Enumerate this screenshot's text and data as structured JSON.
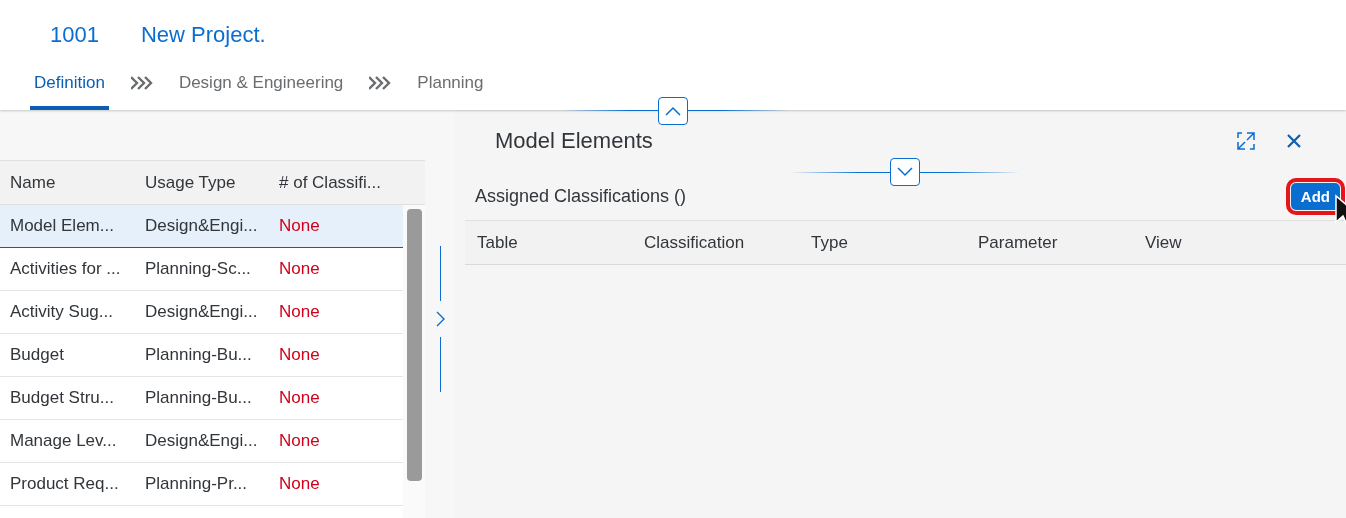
{
  "header": {
    "id": "1001",
    "title": "New Project."
  },
  "steps": [
    {
      "label": "Definition",
      "selected": true
    },
    {
      "label": "Design & Engineering",
      "selected": false
    },
    {
      "label": "Planning",
      "selected": false
    }
  ],
  "table": {
    "columns": [
      "Name",
      "Usage Type",
      "# of Classifi..."
    ],
    "rows": [
      {
        "name": "Model Elem...",
        "usage": "Design&Engi...",
        "count": "None",
        "selected": true
      },
      {
        "name": "Activities for ...",
        "usage": "Planning-Sc...",
        "count": "None",
        "selected": false
      },
      {
        "name": "Activity Sug...",
        "usage": "Design&Engi...",
        "count": "None",
        "selected": false
      },
      {
        "name": "Budget",
        "usage": "Planning-Bu...",
        "count": "None",
        "selected": false
      },
      {
        "name": "Budget Stru...",
        "usage": "Planning-Bu...",
        "count": "None",
        "selected": false
      },
      {
        "name": "Manage Lev...",
        "usage": "Design&Engi...",
        "count": "None",
        "selected": false
      },
      {
        "name": "Product Req...",
        "usage": "Planning-Pr...",
        "count": "None",
        "selected": false
      }
    ]
  },
  "detail": {
    "title": "Model Elements",
    "section_title": "Assigned Classifications ()",
    "add_button": "Add",
    "columns": [
      "Table",
      "Classification",
      "Type",
      "Parameter",
      "View"
    ]
  }
}
